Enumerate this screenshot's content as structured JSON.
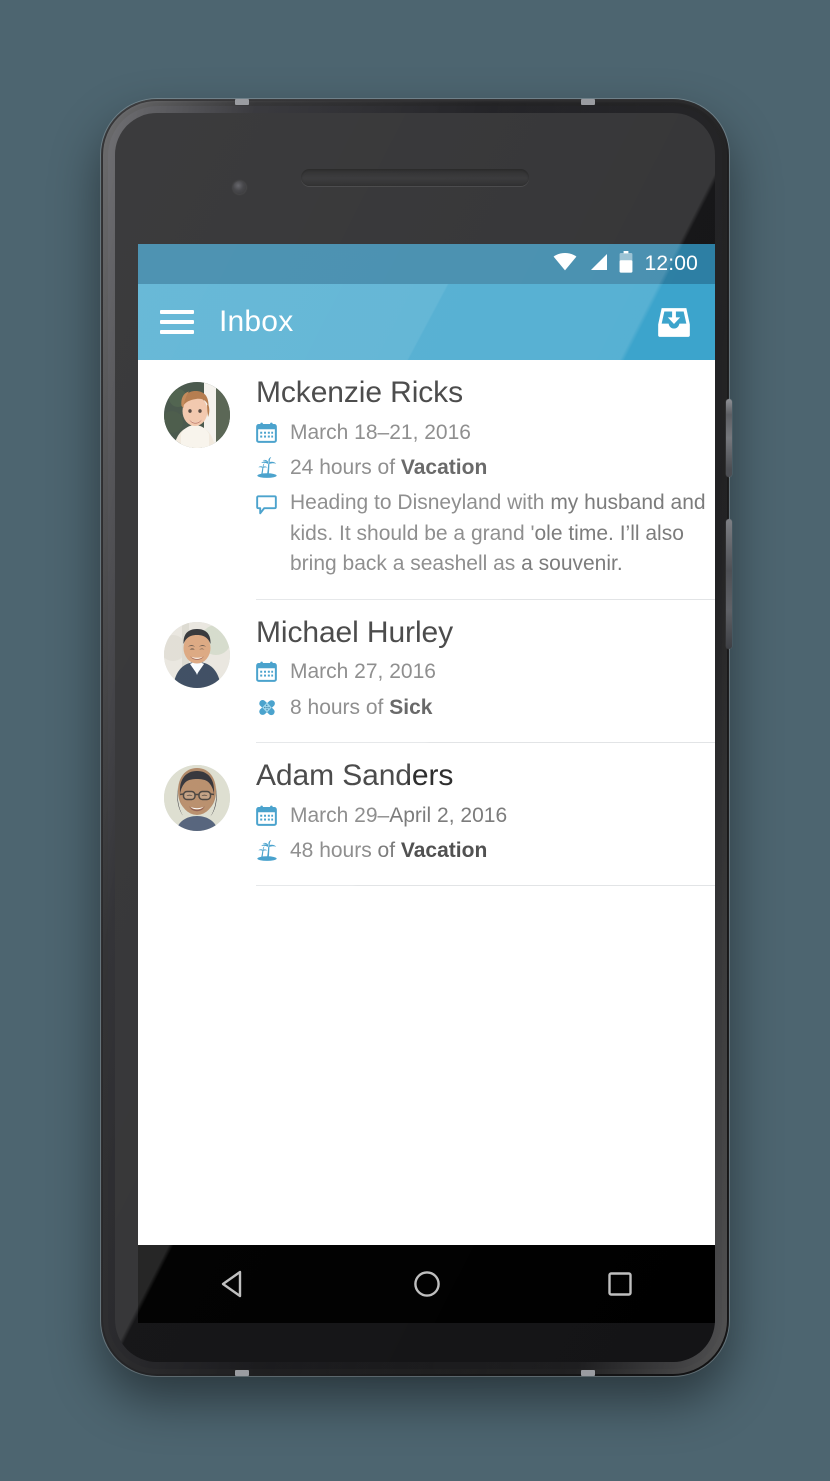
{
  "device": {
    "type": "android-phone",
    "earpiece": "earpiece-speaker",
    "camera": "front-camera"
  },
  "status_bar": {
    "time": "12:00",
    "icons": [
      "wifi-icon",
      "cellular-signal-icon",
      "battery-icon"
    ],
    "background_color": "#2b7ea3"
  },
  "app_bar": {
    "menu_icon": "hamburger-menu-icon",
    "title": "Inbox",
    "action_icon": "inbox-download-icon",
    "background_color": "#3aa3cb",
    "text_color": "#ffffff"
  },
  "accent_color": "#2a92c4",
  "list": {
    "entries": [
      {
        "name": "Mckenzie Ricks",
        "avatar": "avatar-mckenzie-ricks",
        "date": "March 18–21, 2016",
        "date_icon": "calendar-icon",
        "duration_prefix": "24 hours of ",
        "leave_type": "Vacation",
        "leave_icon": "palm-tree-island-icon",
        "note": "Heading to Disneyland with my husband and kids. It should be a grand 'ole time. I’ll also bring back a seashell as a souvenir.",
        "note_icon": "comment-bubble-icon"
      },
      {
        "name": "Michael Hurley",
        "avatar": "avatar-michael-hurley",
        "date": "March 27, 2016",
        "date_icon": "calendar-icon",
        "duration_prefix": "8 hours of ",
        "leave_type": "Sick",
        "leave_icon": "bandages-icon",
        "note": "",
        "note_icon": ""
      },
      {
        "name": "Adam Sanders",
        "avatar": "avatar-adam-sanders",
        "date": "March 29–April 2, 2016",
        "date_icon": "calendar-icon",
        "duration_prefix": "48 hours of ",
        "leave_type": "Vacation",
        "leave_icon": "palm-tree-island-icon",
        "note": "",
        "note_icon": ""
      }
    ]
  },
  "navigation_bar": {
    "back": "back-triangle-icon",
    "home": "home-circle-icon",
    "recents": "recents-square-icon",
    "background_color": "#000000"
  },
  "page_background_color": "#4d6570"
}
